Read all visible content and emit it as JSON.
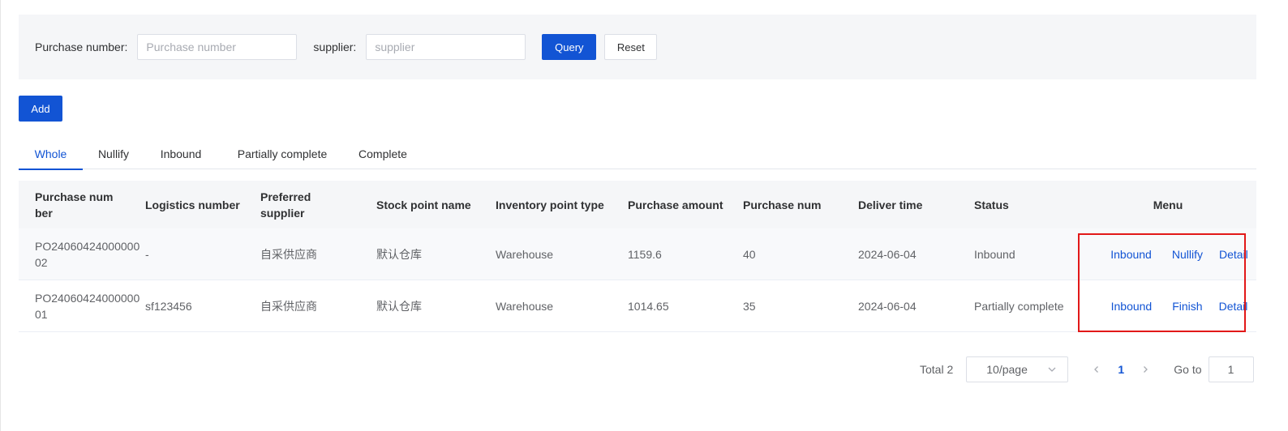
{
  "filters": {
    "purchase_number_label": "Purchase number:",
    "purchase_number_placeholder": "Purchase number",
    "purchase_number_value": "",
    "supplier_label": "supplier:",
    "supplier_placeholder": "supplier",
    "supplier_value": "",
    "query_label": "Query",
    "reset_label": "Reset"
  },
  "add_label": "Add",
  "tabs": [
    {
      "label": "Whole",
      "active": true
    },
    {
      "label": "Nullify",
      "active": false
    },
    {
      "label": "Inbound",
      "active": false
    },
    {
      "label": "Partially complete",
      "active": false
    },
    {
      "label": "Complete",
      "active": false
    }
  ],
  "table": {
    "columns": [
      "Purchase number",
      "Logistics number",
      "Preferred supplier",
      "Stock point name",
      "Inventory point type",
      "Purchase amount",
      "Purchase num",
      "Deliver time",
      "Status",
      "Menu"
    ],
    "rows": [
      {
        "purchase_number": "PO2406042400000002",
        "logistics_number": "-",
        "preferred_supplier": "自采供应商",
        "stock_point_name": "默认仓库",
        "inventory_point_type": "Warehouse",
        "purchase_amount": "1159.6",
        "purchase_num": "40",
        "deliver_time": "2024-06-04",
        "status": "Inbound",
        "actions": [
          "Inbound",
          "Nullify",
          "Detail"
        ]
      },
      {
        "purchase_number": "PO2406042400000001",
        "logistics_number": "sf123456",
        "preferred_supplier": "自采供应商",
        "stock_point_name": "默认仓库",
        "inventory_point_type": "Warehouse",
        "purchase_amount": "1014.65",
        "purchase_num": "35",
        "deliver_time": "2024-06-04",
        "status": "Partially complete",
        "actions": [
          "Inbound",
          "Finish",
          "Detail"
        ]
      }
    ]
  },
  "pagination": {
    "total_text": "Total 2",
    "page_size": "10/page",
    "current_page": "1",
    "goto_label": "Go to",
    "goto_value": "1"
  },
  "colors": {
    "primary": "#1254d4",
    "highlight": "#e21818"
  }
}
